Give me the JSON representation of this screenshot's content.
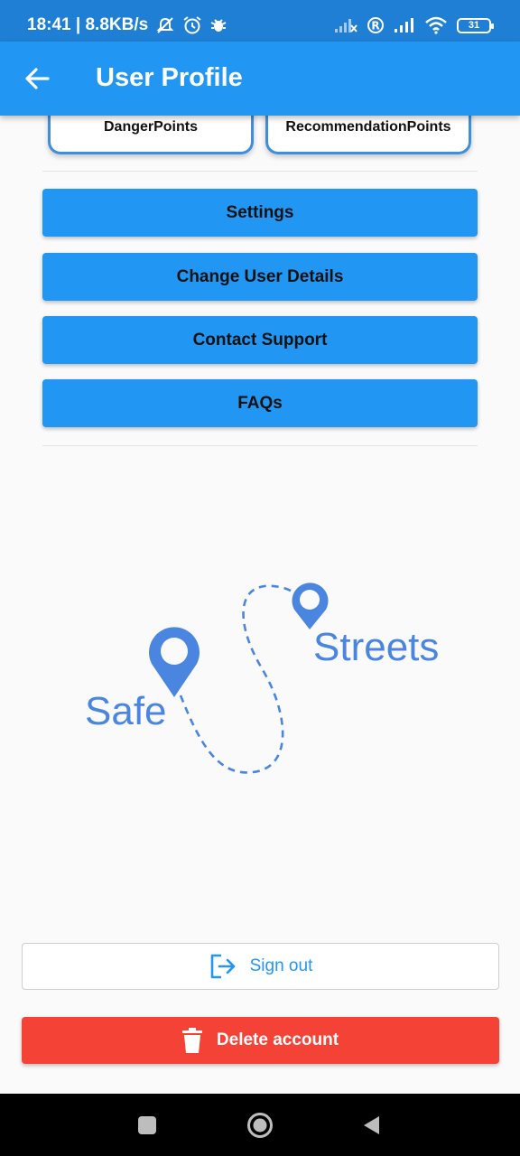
{
  "status_bar": {
    "time_speed": "18:41 | 8.8KB/s",
    "battery": "31",
    "icons": [
      "mute-icon",
      "alarm-icon",
      "bug-icon",
      "no-signal-icon",
      "r-icon",
      "signal-icon",
      "wifi-icon",
      "battery-icon"
    ]
  },
  "app_bar": {
    "title": "User Profile",
    "back_icon": "arrow-left-icon"
  },
  "points": {
    "danger_label": "DangerPoints",
    "recommendation_label": "RecommendationPoints"
  },
  "menu": [
    {
      "label": "Settings"
    },
    {
      "label": "Change User Details"
    },
    {
      "label": "Contact Support"
    },
    {
      "label": "FAQs"
    }
  ],
  "logo": {
    "word1": "Safe",
    "word2": "Streets"
  },
  "actions": {
    "sign_out": "Sign out",
    "delete_account": "Delete account"
  },
  "colors": {
    "primary": "#2196f3",
    "status_bar": "#1f7fd4",
    "danger": "#f44336",
    "logo_blue": "#4a86e0"
  },
  "nav": {
    "icons": [
      "square-icon",
      "circle-icon",
      "back-triangle-icon"
    ]
  }
}
